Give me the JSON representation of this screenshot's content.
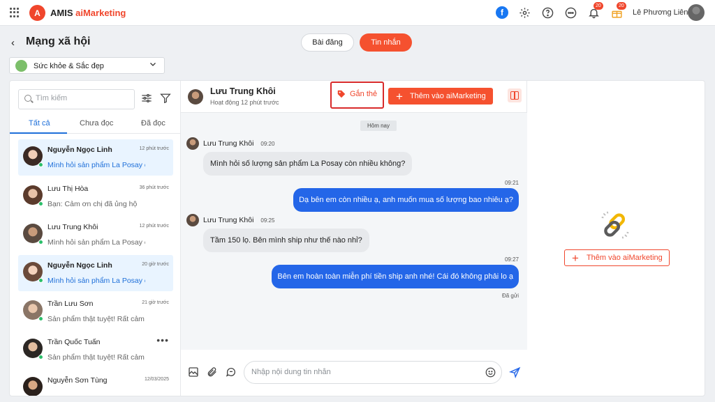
{
  "app": {
    "brand_prefix": "AMIS",
    "brand_accent": "aiMarketing",
    "logo_letter": "A"
  },
  "topbar": {
    "notif_count": "20",
    "promo_count": "20",
    "user_name": "Lê Phương Liên",
    "facebook_glyph": "f"
  },
  "page": {
    "title": "Mạng xã hội",
    "segments": {
      "posts": "Bài đăng",
      "messages": "Tin nhắn"
    },
    "selected_page": "Sức khỏe & Sắc đẹp"
  },
  "sidebar": {
    "search_placeholder": "Tìm kiếm",
    "tabs": [
      "Tất cả",
      "Chưa đọc",
      "Đã đọc"
    ],
    "conversations": [
      {
        "name": "Nguyễn Ngọc Linh",
        "time": "12 phút trước",
        "snippet": "Mình hỏi sản phẩm La Posay còn nhiều không?",
        "unread": true,
        "selected": true
      },
      {
        "name": "Lưu Thị Hòa",
        "time": "36 phút trước",
        "snippet": "Bạn: Cảm ơn chị đã ủng hộ",
        "unread": false,
        "selected": false
      },
      {
        "name": "Lưu Trung Khôi",
        "time": "12 phút trước",
        "snippet": "Mình hỏi sản phẩm La Posay còn nhiều không?",
        "unread": false,
        "selected": false
      },
      {
        "name": "Nguyễn Ngọc Linh",
        "time": "20 giờ trước",
        "snippet": "Mình hỏi sản phẩm La Posay còn nhiều không?",
        "unread": true,
        "selected": true
      },
      {
        "name": "Trần Lưu Sơn",
        "time": "21 giờ trước",
        "snippet": "Sản phẩm thật tuyệt! Rất cảm ơn",
        "unread": false,
        "selected": false
      },
      {
        "name": "Trần Quốc Tuấn",
        "time": "",
        "snippet": "Sản phẩm thật tuyệt! Rất cảm ơn",
        "unread": false,
        "selected": false
      },
      {
        "name": "Nguyễn Sơn Tùng",
        "time": "12/03/2025",
        "snippet": "",
        "unread": false,
        "selected": false
      }
    ]
  },
  "chat": {
    "contact_name": "Lưu Trung Khôi",
    "status": "Hoạt động 12 phút trước",
    "tag_button": "Gắn thẻ",
    "add_button": "Thêm vào aiMarketing",
    "day_label": "Hôm nay",
    "messages": [
      {
        "dir": "in",
        "sender": "Lưu Trung Khôi",
        "time": "09:20",
        "text": "Mình hỏi số lượng sản phẩm La Posay còn nhiều không?"
      },
      {
        "dir": "out",
        "time": "09:21",
        "text": "Dạ bên em còn nhiều ạ, anh muốn mua số lượng bao nhiêu ạ?"
      },
      {
        "dir": "in",
        "sender": "Lưu Trung Khôi",
        "time": "09:25",
        "text": "Tầm 150 lọ. Bên mình ship như thế nào nhỉ?"
      },
      {
        "dir": "out",
        "time": "09:27",
        "text": "Bên em hoàn toàn miễn phí tiền ship anh nhé! Cái đó không phải lo ạ"
      }
    ],
    "sent_status": "Đã gửi",
    "input_placeholder": "Nhập nội dung tin nhắn"
  },
  "right_panel": {
    "add_button": "Thêm vào aiMarketing"
  },
  "colors": {
    "accent": "#f5512f",
    "blue": "#2466e8",
    "link_tab": "#1e6fd9"
  }
}
